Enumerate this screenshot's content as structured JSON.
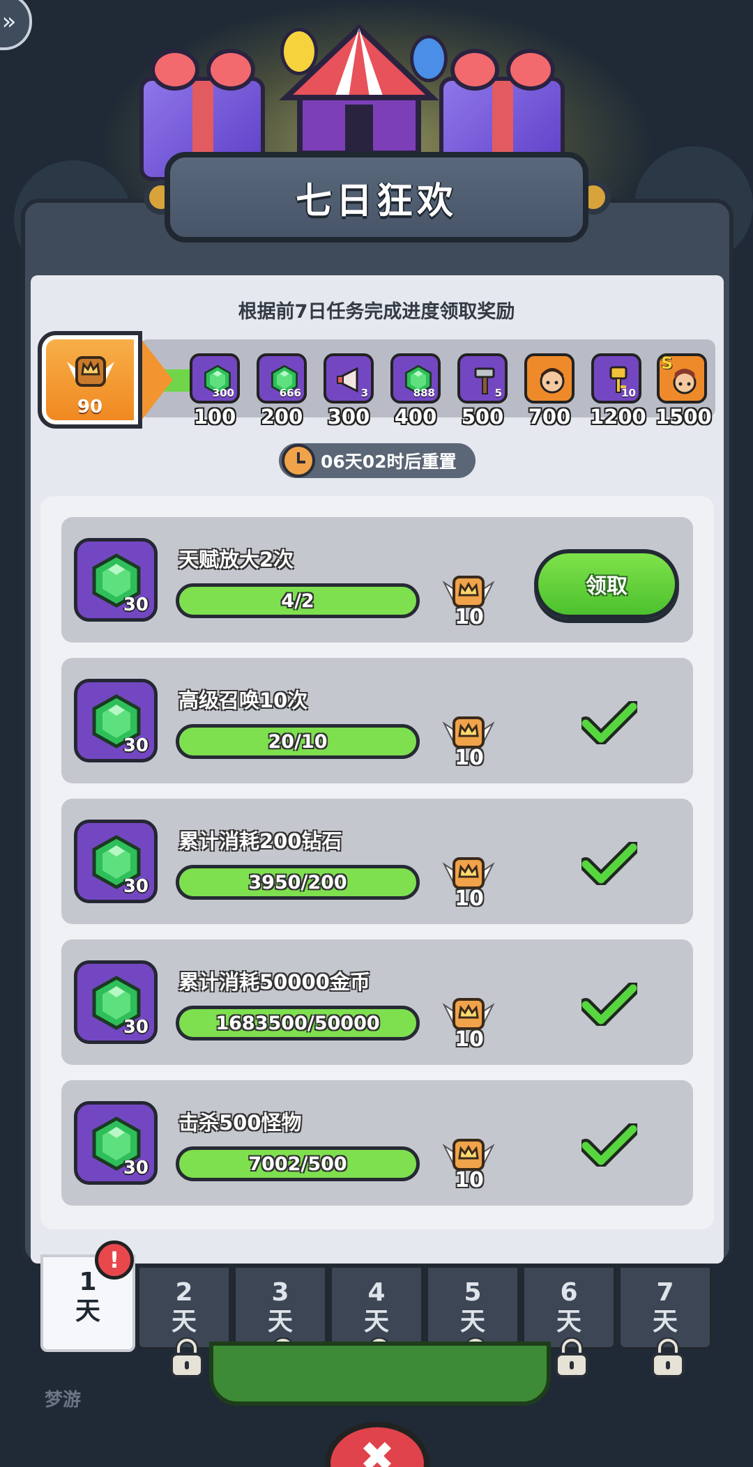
{
  "header": {
    "title": "七日狂欢"
  },
  "subtitle": "根据前7日任务完成进度领取奖励",
  "progress": {
    "current_points": "90",
    "milestones": [
      {
        "points": "100",
        "reward_icon": "emerald-gem-icon",
        "reward_qty": "300"
      },
      {
        "points": "200",
        "reward_icon": "emerald-gem-icon",
        "reward_qty": "666"
      },
      {
        "points": "300",
        "reward_icon": "megaphone-icon",
        "reward_qty": "3"
      },
      {
        "points": "400",
        "reward_icon": "emerald-gem-icon",
        "reward_qty": "888"
      },
      {
        "points": "500",
        "reward_icon": "hammer-icon",
        "reward_qty": "5"
      },
      {
        "points": "700",
        "reward_icon": "hero-portrait-icon",
        "reward_qty": ""
      },
      {
        "points": "1200",
        "reward_icon": "key-icon",
        "reward_qty": "10"
      },
      {
        "points": "1500",
        "reward_icon": "s-hero-portrait-icon",
        "reward_qty": "",
        "rank_badge": "S"
      }
    ]
  },
  "timer": {
    "text": "06天02时后重置"
  },
  "tasks": [
    {
      "name": "天赋放大2次",
      "progress": "4/2",
      "reward_qty": "30",
      "points": "10",
      "state": "claim",
      "claim_label": "领取"
    },
    {
      "name": "高级召唤10次",
      "progress": "20/10",
      "reward_qty": "30",
      "points": "10",
      "state": "done"
    },
    {
      "name": "累计消耗200钻石",
      "progress": "3950/200",
      "reward_qty": "30",
      "points": "10",
      "state": "done"
    },
    {
      "name": "累计消耗50000金币",
      "progress": "1683500/50000",
      "reward_qty": "30",
      "points": "10",
      "state": "done"
    },
    {
      "name": "击杀500怪物",
      "progress": "7002/500",
      "reward_qty": "30",
      "points": "10",
      "state": "done"
    }
  ],
  "day_tabs": [
    {
      "num": "1",
      "unit": "天",
      "active": true,
      "locked": false,
      "alert": "!"
    },
    {
      "num": "2",
      "unit": "天",
      "active": false,
      "locked": true
    },
    {
      "num": "3",
      "unit": "天",
      "active": false,
      "locked": true
    },
    {
      "num": "4",
      "unit": "天",
      "active": false,
      "locked": true
    },
    {
      "num": "5",
      "unit": "天",
      "active": false,
      "locked": true
    },
    {
      "num": "6",
      "unit": "天",
      "active": false,
      "locked": true
    },
    {
      "num": "7",
      "unit": "天",
      "active": false,
      "locked": true
    }
  ],
  "background": {
    "side_label": "梦游"
  },
  "colors": {
    "accent_green": "#6fd64a",
    "reward_purple": "#7447c2",
    "points_orange": "#f0861f",
    "close_red": "#e0434b"
  }
}
